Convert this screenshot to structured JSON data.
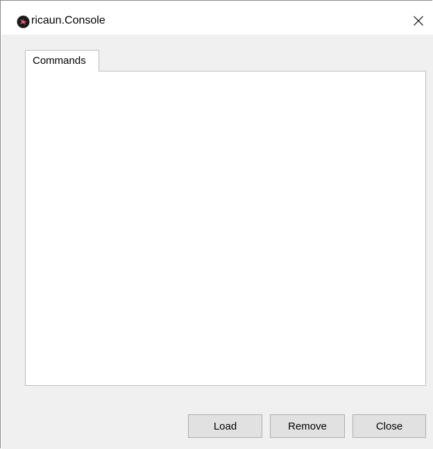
{
  "window": {
    "title": "ricaun.Console",
    "close_glyph": "✕",
    "icon": "ricaun-app-icon"
  },
  "tabs": [
    {
      "label": "Commands",
      "selected": true
    }
  ],
  "buttons": {
    "load_label": "Load",
    "remove_label": "Remove",
    "close_label": "Close"
  },
  "colors": {
    "app_icon_ring": "#1a1a1a",
    "app_icon_fill": "#e85a6a",
    "client_bg": "#f0f0f0",
    "button_bg": "#e1e1e1"
  }
}
